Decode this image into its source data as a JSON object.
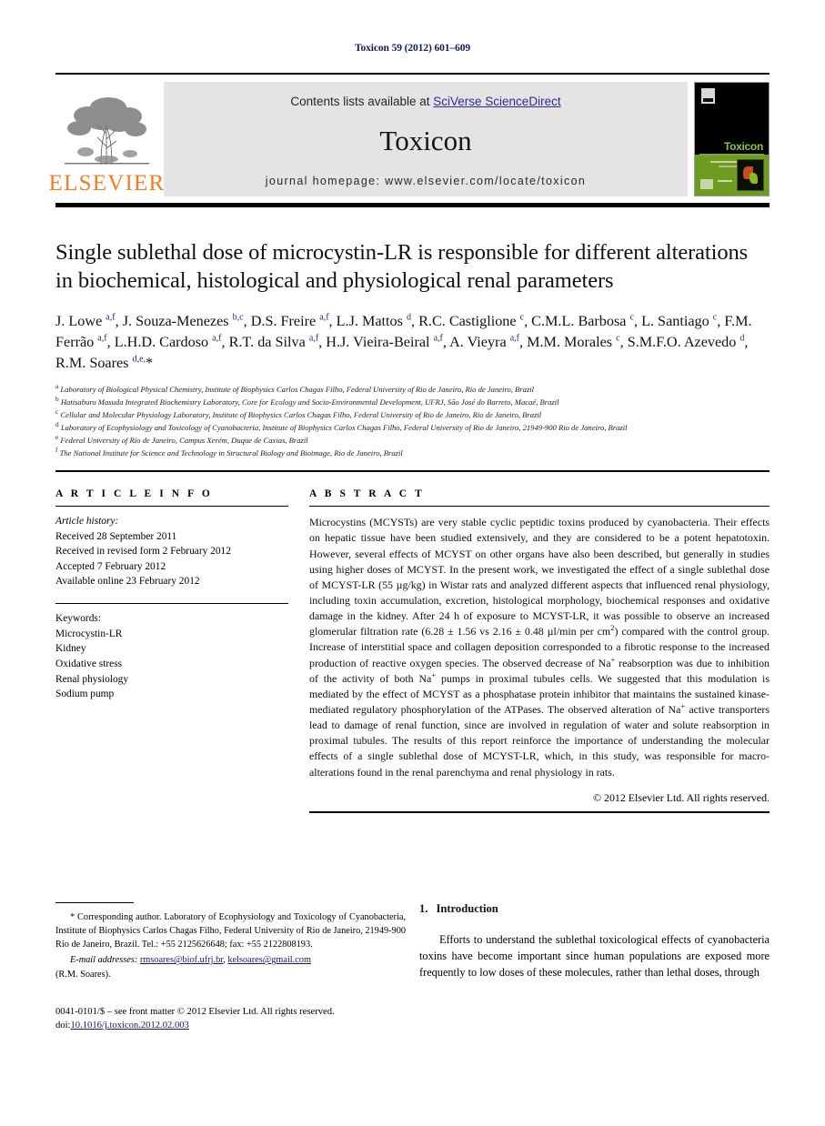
{
  "running_head": "Toxicon 59 (2012) 601–609",
  "masthead": {
    "publisher_name": "ELSEVIER",
    "contents_prefix": "Contents lists available at ",
    "contents_link": "SciVerse ScienceDirect",
    "journal_title": "Toxicon",
    "homepage": "journal homepage: www.elsevier.com/locate/toxicon",
    "cover_title": "Toxicon"
  },
  "article": {
    "title": "Single sublethal dose of microcystin-LR is responsible for different alterations in biochemical, histological and physiological renal parameters",
    "authors_html": "J. Lowe <sup>a,f</sup>, J. Souza-Menezes <sup>b,c</sup>, D.S. Freire <sup>a,f</sup>, L.J. Mattos <sup>d</sup>, R.C. Castiglione <sup>c</sup>, C.M.L. Barbosa <sup>c</sup>, L. Santiago <sup>c</sup>, F.M. Ferrão <sup>a,f</sup>, L.H.D. Cardoso <sup>a,f</sup>, R.T. da Silva <sup>a,f</sup>, H.J. Vieira-Beiral <sup>a,f</sup>, A. Vieyra <sup>a,f</sup>, M.M. Morales <sup>c</sup>, S.M.F.O. Azevedo <sup>d</sup>, R.M. Soares <sup>d,e,</sup>*",
    "affiliations": [
      {
        "marker": "a",
        "text": "Laboratory of Biological Physical Chemistry, Institute of Biophysics Carlos Chagas Filho, Federal University of Rio de Janeiro, Rio de Janeiro, Brazil"
      },
      {
        "marker": "b",
        "text": "Hatisaburo Masuda Integrated Biochemistry Laboratory, Core for Ecology and Socio-Environmental Development, UFRJ, São José do Barreto, Macaé, Brazil"
      },
      {
        "marker": "c",
        "text": "Cellular and Molecular Physiology Laboratory, Institute of Biophysics Carlos Chagas Filho, Federal University of Rio de Janeiro, Rio de Janeiro, Brazil"
      },
      {
        "marker": "d",
        "text": "Laboratory of Ecophysiology and Toxicology of Cyanobacteria, Institute of Biophysics Carlos Chagas Filho, Federal University of Rio de Janeiro, 21949-900 Rio de Janeiro, Brazil"
      },
      {
        "marker": "e",
        "text": "Federal University of Rio de Janeiro, Campus Xerém, Duque de Caxias, Brazil"
      },
      {
        "marker": "f",
        "text": "The National Institute for Science and Technology in Structural Biology and Bioimage, Rio de Janeiro, Brazil"
      }
    ]
  },
  "article_info": {
    "heading": "A R T I C L E  I N F O",
    "history_label": "Article history:",
    "history": [
      "Received 28 September 2011",
      "Received in revised form 2 February 2012",
      "Accepted 7 February 2012",
      "Available online 23 February 2012"
    ],
    "keywords_label": "Keywords:",
    "keywords": [
      "Microcystin-LR",
      "Kidney",
      "Oxidative stress",
      "Renal physiology",
      "Sodium pump"
    ]
  },
  "abstract": {
    "heading": "A B S T R A C T",
    "body_html": "Microcystins (MCYSTs) are very stable cyclic peptidic toxins produced by cyanobacteria. Their effects on hepatic tissue have been studied extensively, and they are considered to be a potent hepatotoxin. However, several effects of MCYST on other organs have also been described, but generally in studies using higher doses of MCYST. In the present work, we investigated the effect of a single sublethal dose of MCYST-LR (55 &micro;g/kg) in Wistar rats and analyzed different aspects that influenced renal physiology, including toxin accumulation, excretion, histological morphology, biochemical responses and oxidative damage in the kidney. After 24 h of exposure to MCYST-LR, it was possible to observe an increased glomerular filtration rate (6.28 &plusmn; 1.56 vs 2.16 &plusmn; 0.48 &micro;l/min per cm<sup>2</sup>) compared with the control group. Increase of interstitial space and collagen deposition corresponded to a fibrotic response to the increased production of reactive oxygen species. The observed decrease of Na<sup>+</sup> reabsorption was due to inhibition of the activity of both Na<sup>+</sup> pumps in proximal tubules cells. We suggested that this modulation is mediated by the effect of MCYST as a phosphatase protein inhibitor that maintains the sustained kinase-mediated regulatory phosphorylation of the ATPases. The observed alteration of Na<sup>+</sup> active transporters lead to damage of renal function, since are involved in regulation of water and solute reabsorption in proximal tubules. The results of this report reinforce the importance of understanding the molecular effects of a single sublethal dose of MCYST-LR, which, in this study, was responsible for macro-alterations found in the renal parenchyma and renal physiology in rats.",
    "copyright": "© 2012 Elsevier Ltd. All rights reserved."
  },
  "footer": {
    "corresponding_html": "* Corresponding author. Laboratory of Ecophysiology and Toxicology of Cyanobacteria, Institute of Biophysics Carlos Chagas Filho, Federal University of Rio de Janeiro, 21949-900 Rio de Janeiro, Brazil. Tel.: +55 2125626648; fax: +55 2122808193.",
    "email_label": "E-mail addresses:",
    "email_1": "rmsoares@biof.ufrj.br",
    "email_2": "kelsoares@gmail.com",
    "email_owner": "(R.M. Soares).",
    "issn_line": "0041-0101/$ – see front matter © 2012 Elsevier Ltd. All rights reserved.",
    "doi_label": "doi:",
    "doi_value": "10.1016/j.toxicon.2012.02.003"
  },
  "introduction": {
    "number": "1.",
    "heading": "Introduction",
    "paragraph": "Efforts to understand the sublethal toxicological effects of cyanobacteria toxins have become important since human populations are exposed more frequently to low doses of these molecules, rather than lethal doses, through"
  },
  "colors": {
    "link_navy": "#151a5c",
    "elsevier_orange": "#f47c20",
    "sciverse_blue": "#2d2d8f",
    "cover_green": "#6d9c21",
    "banner_gray": "#e4e4e4"
  }
}
